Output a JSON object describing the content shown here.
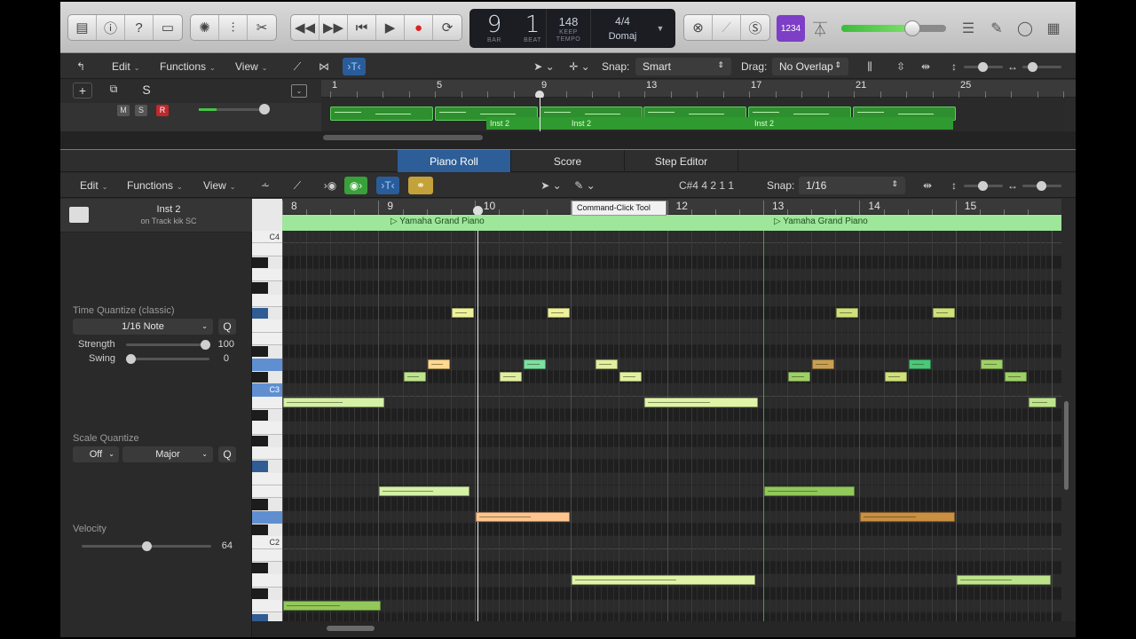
{
  "control_bar": {
    "lcd": {
      "bar": "9",
      "beat": "1",
      "bar_label": "BAR",
      "beat_label": "BEAT",
      "tempo": "148",
      "tempo_mode": "KEEP",
      "tempo_label": "TEMPO",
      "time_signature": "4/4",
      "key": "Domaj"
    },
    "count_in_label": "1234",
    "master_volume": 0.68,
    "active_color": "#7c3fc6"
  },
  "tracks_toolbar": {
    "edit_label": "Edit",
    "functions_label": "Functions",
    "view_label": "View",
    "snap_label": "Snap:",
    "snap_value": "Smart",
    "drag_label": "Drag:",
    "drag_value": "No Overlap"
  },
  "tracks_ruler": {
    "bars": [
      "1",
      "5",
      "9",
      "13",
      "17",
      "21",
      "25"
    ]
  },
  "track_controls": {
    "mute": "M",
    "solo": "S",
    "record": "R",
    "add": "+",
    "s_button": "S"
  },
  "track_regions": [
    {
      "label": "Inst 2"
    },
    {
      "label": "Inst 2"
    },
    {
      "label": "Inst 2"
    }
  ],
  "editor_tabs": [
    {
      "label": "Piano Roll",
      "active": true
    },
    {
      "label": "Score",
      "active": false
    },
    {
      "label": "Step Editor",
      "active": false
    }
  ],
  "editor_toolbar": {
    "edit_label": "Edit",
    "functions_label": "Functions",
    "view_label": "View",
    "position_readout": "C#4  4 2 1 1",
    "snap_label": "Snap:",
    "snap_value": "1/16"
  },
  "tooltip": "Command-Click Tool",
  "inspector": {
    "track_name": "Inst 2",
    "track_sub": "on Track kik SC",
    "time_quantize_label": "Time Quantize (classic)",
    "time_quantize_value": "1/16 Note",
    "strength_label": "Strength",
    "strength_value": "100",
    "swing_label": "Swing",
    "swing_value": "0",
    "scale_quantize_label": "Scale Quantize",
    "scale_quantize_off": "Off",
    "scale_quantize_mode": "Major",
    "velocity_label": "Velocity",
    "velocity_value": "64",
    "q_label": "Q"
  },
  "roll_ruler": {
    "bars": [
      "8",
      "9",
      "10",
      "11",
      "12",
      "13",
      "14",
      "15"
    ]
  },
  "region_names": [
    "Yamaha Grand Piano",
    "Yamaha Grand Piano"
  ],
  "key_labels": {
    "c4": "C4",
    "c3": "C3",
    "c2": "C2"
  },
  "notes": [
    {
      "start": 8.0,
      "len": 1.07,
      "pitch": 59,
      "color": "#d4f1a6"
    },
    {
      "start": 8.0,
      "len": 1.03,
      "pitch": 43,
      "color": "#92c95a"
    },
    {
      "start": 9.0,
      "len": 0.96,
      "pitch": 52,
      "color": "#d4f1a6"
    },
    {
      "start": 9.25,
      "len": 0.25,
      "pitch": 61,
      "color": "#bde48c"
    },
    {
      "start": 9.5,
      "len": 0.25,
      "pitch": 62,
      "color": "#ffd98f"
    },
    {
      "start": 9.75,
      "len": 0.25,
      "pitch": 66,
      "color": "#eef29a"
    },
    {
      "start": 10.0,
      "len": 1.0,
      "pitch": 50,
      "color": "#ffc58e"
    },
    {
      "start": 10.25,
      "len": 0.25,
      "pitch": 61,
      "color": "#e0f0a0"
    },
    {
      "start": 10.5,
      "len": 0.25,
      "pitch": 62,
      "color": "#7be0a0"
    },
    {
      "start": 10.75,
      "len": 0.25,
      "pitch": 66,
      "color": "#eef29a"
    },
    {
      "start": 11.0,
      "len": 1.93,
      "pitch": 45,
      "color": "#e0f4a8"
    },
    {
      "start": 11.25,
      "len": 0.25,
      "pitch": 62,
      "color": "#e0f0a0"
    },
    {
      "start": 11.5,
      "len": 0.25,
      "pitch": 61,
      "color": "#e0f0a0"
    },
    {
      "start": 11.75,
      "len": 1.2,
      "pitch": 59,
      "color": "#e0f4a8"
    },
    {
      "start": 13.0,
      "len": 0.96,
      "pitch": 52,
      "color": "#92c95a"
    },
    {
      "start": 13.25,
      "len": 0.25,
      "pitch": 61,
      "color": "#9dd066"
    },
    {
      "start": 13.5,
      "len": 0.25,
      "pitch": 62,
      "color": "#caa052"
    },
    {
      "start": 13.75,
      "len": 0.25,
      "pitch": 66,
      "color": "#d0e07a"
    },
    {
      "start": 14.0,
      "len": 1.0,
      "pitch": 50,
      "color": "#c98f42"
    },
    {
      "start": 14.25,
      "len": 0.25,
      "pitch": 61,
      "color": "#d0e07a"
    },
    {
      "start": 14.5,
      "len": 0.25,
      "pitch": 62,
      "color": "#48c878"
    },
    {
      "start": 14.75,
      "len": 0.25,
      "pitch": 66,
      "color": "#d0e07a"
    },
    {
      "start": 15.0,
      "len": 1.0,
      "pitch": 45,
      "color": "#bde48c"
    },
    {
      "start": 15.25,
      "len": 0.25,
      "pitch": 62,
      "color": "#9dd066"
    },
    {
      "start": 15.5,
      "len": 0.25,
      "pitch": 61,
      "color": "#9dd066"
    },
    {
      "start": 15.75,
      "len": 0.3,
      "pitch": 59,
      "color": "#bde48c"
    }
  ]
}
